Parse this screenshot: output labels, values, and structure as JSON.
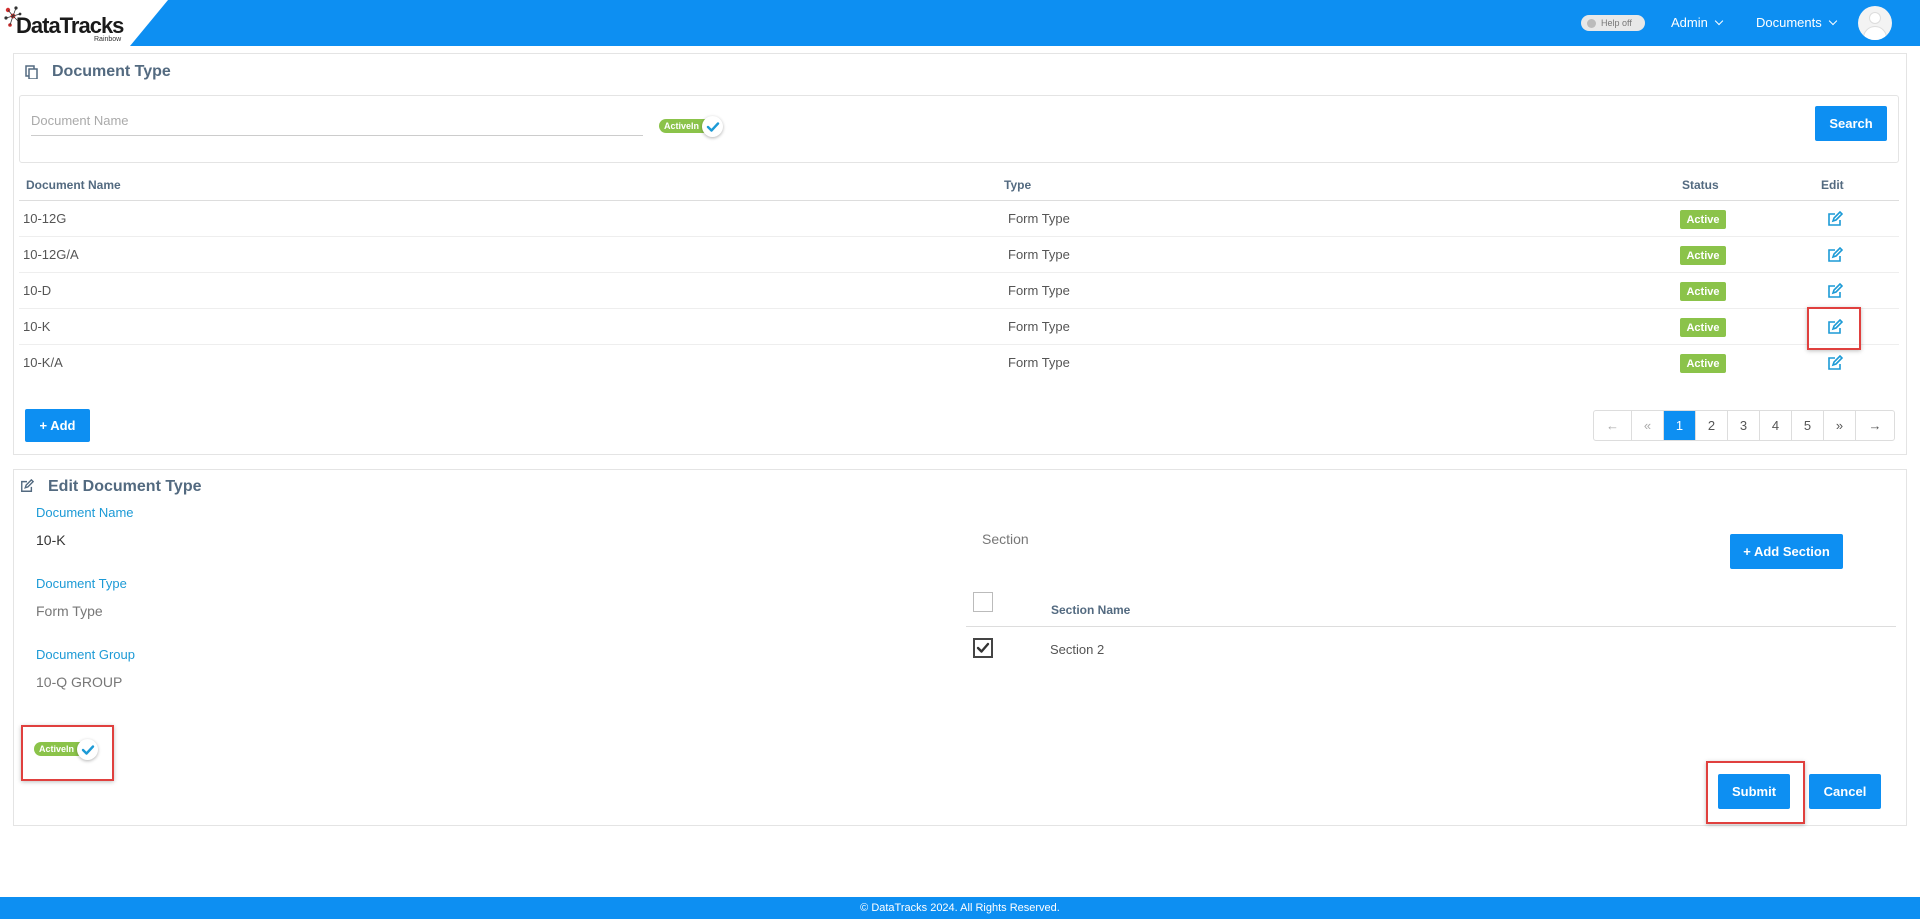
{
  "header": {
    "logo_text": "DataTracks",
    "logo_sub": "Rainbow",
    "help_toggle": "Help off",
    "admin_label": "Admin",
    "documents_label": "Documents"
  },
  "doc_type_panel": {
    "title": "Document Type",
    "search_placeholder": "Document Name",
    "switch_label": "ActiveIn",
    "search_button": "Search",
    "columns": [
      "Document Name",
      "Type",
      "Status",
      "Edit"
    ],
    "rows": [
      {
        "name": "10-12G",
        "type": "Form Type",
        "status": "Active"
      },
      {
        "name": "10-12G/A",
        "type": "Form Type",
        "status": "Active"
      },
      {
        "name": "10-D",
        "type": "Form Type",
        "status": "Active"
      },
      {
        "name": "10-K",
        "type": "Form Type",
        "status": "Active"
      },
      {
        "name": "10-K/A",
        "type": "Form Type",
        "status": "Active"
      }
    ],
    "add_button": "+ Add",
    "pagination": [
      "←",
      "«",
      "1",
      "2",
      "3",
      "4",
      "5",
      "»",
      "→"
    ],
    "current_page": "1"
  },
  "edit_panel": {
    "title": "Edit Document Type",
    "doc_name_label": "Document Name",
    "doc_name_value": "10-K",
    "doc_type_label": "Document Type",
    "doc_type_value": "Form Type",
    "doc_group_label": "Document Group",
    "doc_group_value": "10-Q GROUP",
    "switch_label": "ActiveIn",
    "section_label": "Section",
    "add_section_button": "+ Add Section",
    "section_col": "Section Name",
    "sections": [
      {
        "name": "Section 2",
        "checked": true
      }
    ],
    "submit_button": "Submit",
    "cancel_button": "Cancel"
  },
  "footer": {
    "text": "© DataTracks 2024. All Rights Reserved."
  },
  "colors": {
    "primary": "#0d8ff2",
    "active_green": "#8bc34a",
    "label_blue": "#1c9ad6",
    "highlight_red": "#e0403e"
  }
}
